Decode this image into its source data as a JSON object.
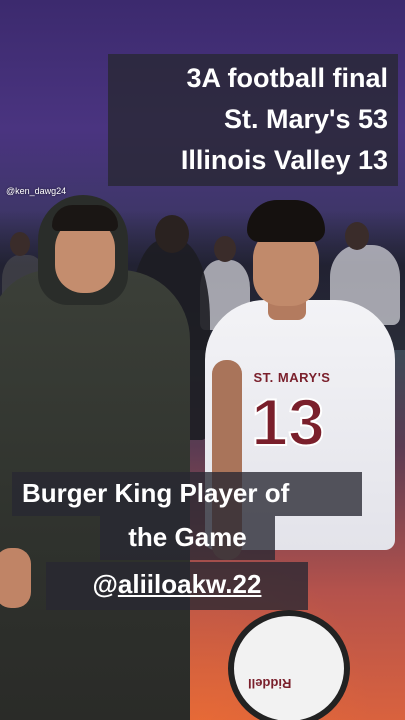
{
  "score_caption": {
    "line1": "3A football final",
    "line2": "St. Mary's 53",
    "line3": "Illinois Valley 13"
  },
  "photo_credit": "@ken_dawg24",
  "award_caption": {
    "line1": "Burger King Player of",
    "line2": "the Game"
  },
  "mention": {
    "at": "@",
    "handle": "aliiloakw.22"
  },
  "jersey": {
    "team": "ST. MARY'S",
    "number": "13"
  },
  "helmet_brand": "Riddell",
  "colors": {
    "jersey_maroon": "#7a1f2b",
    "caption_bg": "#28283299"
  }
}
